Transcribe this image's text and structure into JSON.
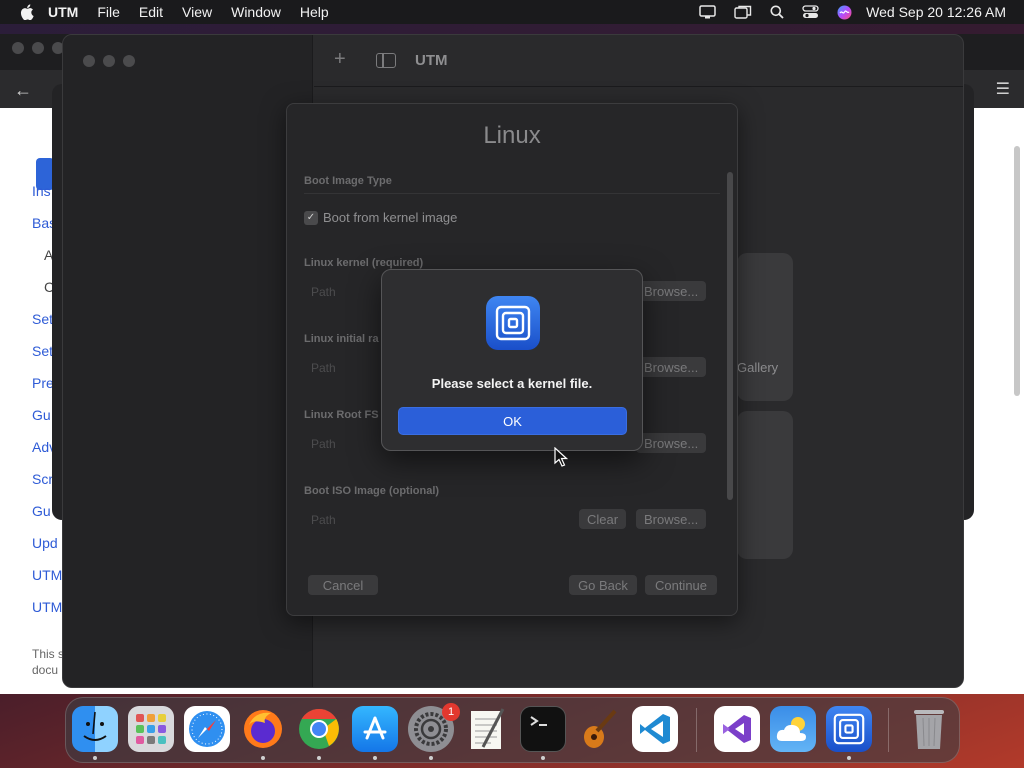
{
  "menubar": {
    "app_name": "UTM",
    "menus": [
      "File",
      "Edit",
      "View",
      "Window",
      "Help"
    ],
    "clock": "Wed Sep 20  12:26 AM"
  },
  "background_window": {
    "side_links": [
      "Ins",
      "Bas",
      "Set",
      "Set",
      "Pre",
      "Gu",
      "Adv",
      "Scr",
      "Gu",
      "Upd",
      "UTM",
      "UTM"
    ],
    "side_subitems": [
      "A",
      "C"
    ],
    "note_lines": [
      "This s",
      "docu"
    ]
  },
  "utm_window": {
    "title": "UTM",
    "gallery_label": "Gallery"
  },
  "sheet": {
    "title": "Linux",
    "boot_image_type_label": "Boot Image Type",
    "boot_from_kernel_label": "Boot from kernel image",
    "kernel_label": "Linux kernel (required)",
    "initial_ramdisk_label": "Linux initial ra",
    "root_fs_label": "Linux Root FS",
    "boot_iso_label": "Boot ISO Image (optional)",
    "path_placeholder": "Path",
    "browse_label": "Browse...",
    "clear_label": "Clear",
    "cancel_label": "Cancel",
    "go_back_label": "Go Back",
    "continue_label": "Continue"
  },
  "alert": {
    "message": "Please select a kernel file.",
    "ok_label": "OK"
  },
  "dock": {
    "apps": [
      "Finder",
      "Launchpad",
      "Safari",
      "Firefox",
      "Chrome",
      "App Store",
      "System Settings",
      "TextEdit",
      "Terminal",
      "GarageBand",
      "Visual Studio Code",
      "Visual Studio",
      "Weather",
      "UTM",
      "Trash"
    ],
    "settings_badge": "1"
  }
}
